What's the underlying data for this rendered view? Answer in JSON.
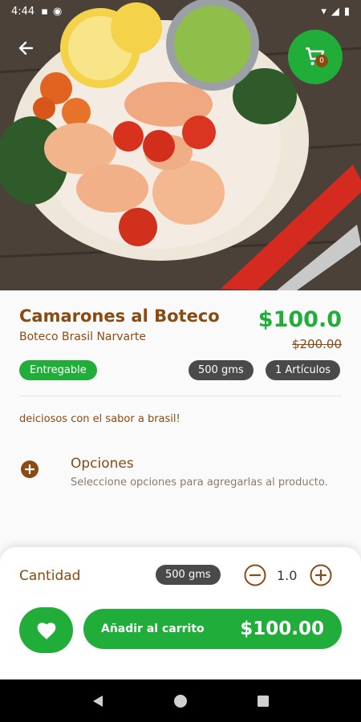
{
  "status_bar": {
    "time": "4:44"
  },
  "cart": {
    "count": "0"
  },
  "product": {
    "name": "Camarones al Boteco",
    "store": "Boteco Brasil Narvarte",
    "price": "$100.0",
    "old_price": "$200.00",
    "status_badge": "Entregable",
    "weight": "500 gms",
    "articles": "1 Artículos",
    "description": "deiciosos con el sabor a brasil!"
  },
  "options": {
    "title": "Opciones",
    "subtitle": "Seleccione opciones para agregarlas al producto."
  },
  "bottom": {
    "quantity_label": "Cantidad",
    "weight": "500 gms",
    "quantity": "1.0",
    "add_label": "Añadir al carrito",
    "add_price": "$100.00"
  },
  "colors": {
    "accent_green": "#21ad3a",
    "brand_brown": "#8a4b12"
  },
  "icons": [
    "back-arrow-icon",
    "cart-icon",
    "add-circle-icon",
    "minus-circle-icon",
    "plus-circle-icon",
    "heart-icon",
    "nav-back-icon",
    "nav-home-icon",
    "nav-recents-icon"
  ]
}
